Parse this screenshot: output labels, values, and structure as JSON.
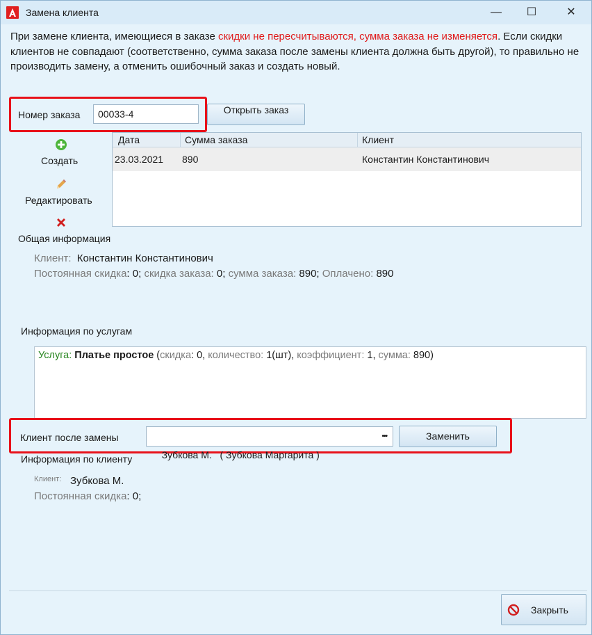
{
  "window": {
    "title": "Замена клиента",
    "app_icon": "app-logo-icon",
    "minimize_glyph": "—",
    "maximize_glyph": "☐",
    "close_glyph": "✕"
  },
  "notice": {
    "part1": "При замене клиента, имеющиеся в заказе ",
    "red": "скидки не пересчитываются, сумма заказа не изменяется",
    "part2": ". Если скидки клиентов не совпадают (соответственно, сумма заказа после замены клиента должна быть другой), то правильно не производить замену, а отменить ошибочный заказ и создать новый."
  },
  "order": {
    "label": "Номер заказа",
    "value": "00033-4",
    "open_button": "Открыть заказ"
  },
  "actions": {
    "create": "Создать",
    "edit": "Редактировать"
  },
  "grid": {
    "columns": [
      "Дата",
      "Сумма заказа",
      "Клиент"
    ],
    "rows": [
      {
        "date": "23.03.2021",
        "sum": "890",
        "client": "Константин Константинович"
      }
    ]
  },
  "general": {
    "heading": "Общая информация",
    "client_label": "Клиент:",
    "client_value": "Константин Константинович",
    "discount_label": "Постоянная скидка",
    "discount_value": ": 0;",
    "order_discount_label": " скидка заказа:",
    "order_discount_value": " 0;",
    "order_sum_label": " сумма заказа:",
    "order_sum_value": " 890;",
    "paid_label": " Оплачено:",
    "paid_value": " 890"
  },
  "services": {
    "heading": "Информация по услугам",
    "service_label": "Услуга:",
    "service_name": "Платье простое",
    "open_paren": " (",
    "discount_label": "скидка",
    "discount_value": ": 0, ",
    "qty_label": "количество:",
    "qty_value": " 1(шт), ",
    "coef_label": "коэффициент:",
    "coef_value": " 1, ",
    "sum_label": "сумма:",
    "sum_value": " 890)"
  },
  "replace": {
    "label": "Клиент после замены",
    "value": "Зубкова М.   ( Зубкова Маргарита )",
    "ellipsis": "•••",
    "button": "Заменить"
  },
  "client_info": {
    "heading": "Информация по клиенту",
    "client_label": "Клиент:",
    "client_value": "Зубкова М.",
    "discount_label": "Постоянная скидка",
    "discount_value": ": 0;"
  },
  "footer": {
    "close_button": "Закрыть"
  },
  "colors": {
    "accent_red": "#e8111a",
    "background": "#e6f3fb",
    "green": "#27851f"
  }
}
